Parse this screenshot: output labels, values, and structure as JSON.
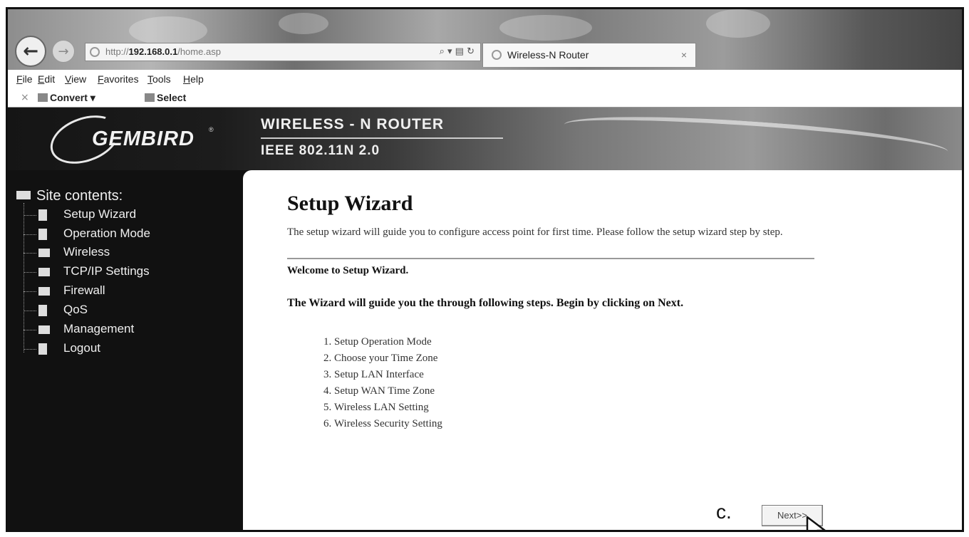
{
  "browser": {
    "address_prefix": "http://",
    "address_host": "192.168.0.1",
    "address_path": "/home.asp",
    "address_tools": "⌕ ▾ ▤ ↻",
    "tab_title": "Wireless-N Router",
    "tab_close": "×",
    "back_glyph": "←",
    "forward_glyph": "→"
  },
  "menu": [
    "File",
    "Edit",
    "View",
    "Favorites",
    "Tools",
    "Help"
  ],
  "toolbar": {
    "close_glyph": "×",
    "convert_label": "Convert",
    "convert_arrow": "▾",
    "select_label": "Select"
  },
  "banner": {
    "brand": "GEMBIRD",
    "brand_mark": "®",
    "title": "WIRELESS - N ROUTER",
    "subtitle": "IEEE 802.11N 2.0"
  },
  "sidebar": {
    "root_label": "Site contents:",
    "items": [
      {
        "label": "Setup Wizard",
        "icon": "page-icon"
      },
      {
        "label": "Operation Mode",
        "icon": "page-icon"
      },
      {
        "label": "Wireless",
        "icon": "folder-icon"
      },
      {
        "label": "TCP/IP Settings",
        "icon": "folder-icon"
      },
      {
        "label": "Firewall",
        "icon": "folder-icon"
      },
      {
        "label": "QoS",
        "icon": "page-icon"
      },
      {
        "label": "Management",
        "icon": "folder-icon"
      },
      {
        "label": "Logout",
        "icon": "page-icon"
      }
    ]
  },
  "content": {
    "title": "Setup Wizard",
    "intro": "The setup wizard will guide you to configure access point for first time. Please follow the setup wizard step by step.",
    "welcome": "Welcome to Setup Wizard.",
    "guide": "The Wizard will guide you the through following steps. Begin by clicking on Next.",
    "steps": [
      "Setup Operation Mode",
      "Choose your Time Zone",
      "Setup LAN Interface",
      "Setup WAN Time Zone",
      "Wireless LAN Setting",
      "Wireless Security Setting"
    ],
    "annotation": "c.",
    "next_button": "Next>>"
  },
  "colors": {
    "sidebar_bg": "#111111",
    "content_bg": "#ffffff",
    "text_dark": "#111111"
  }
}
